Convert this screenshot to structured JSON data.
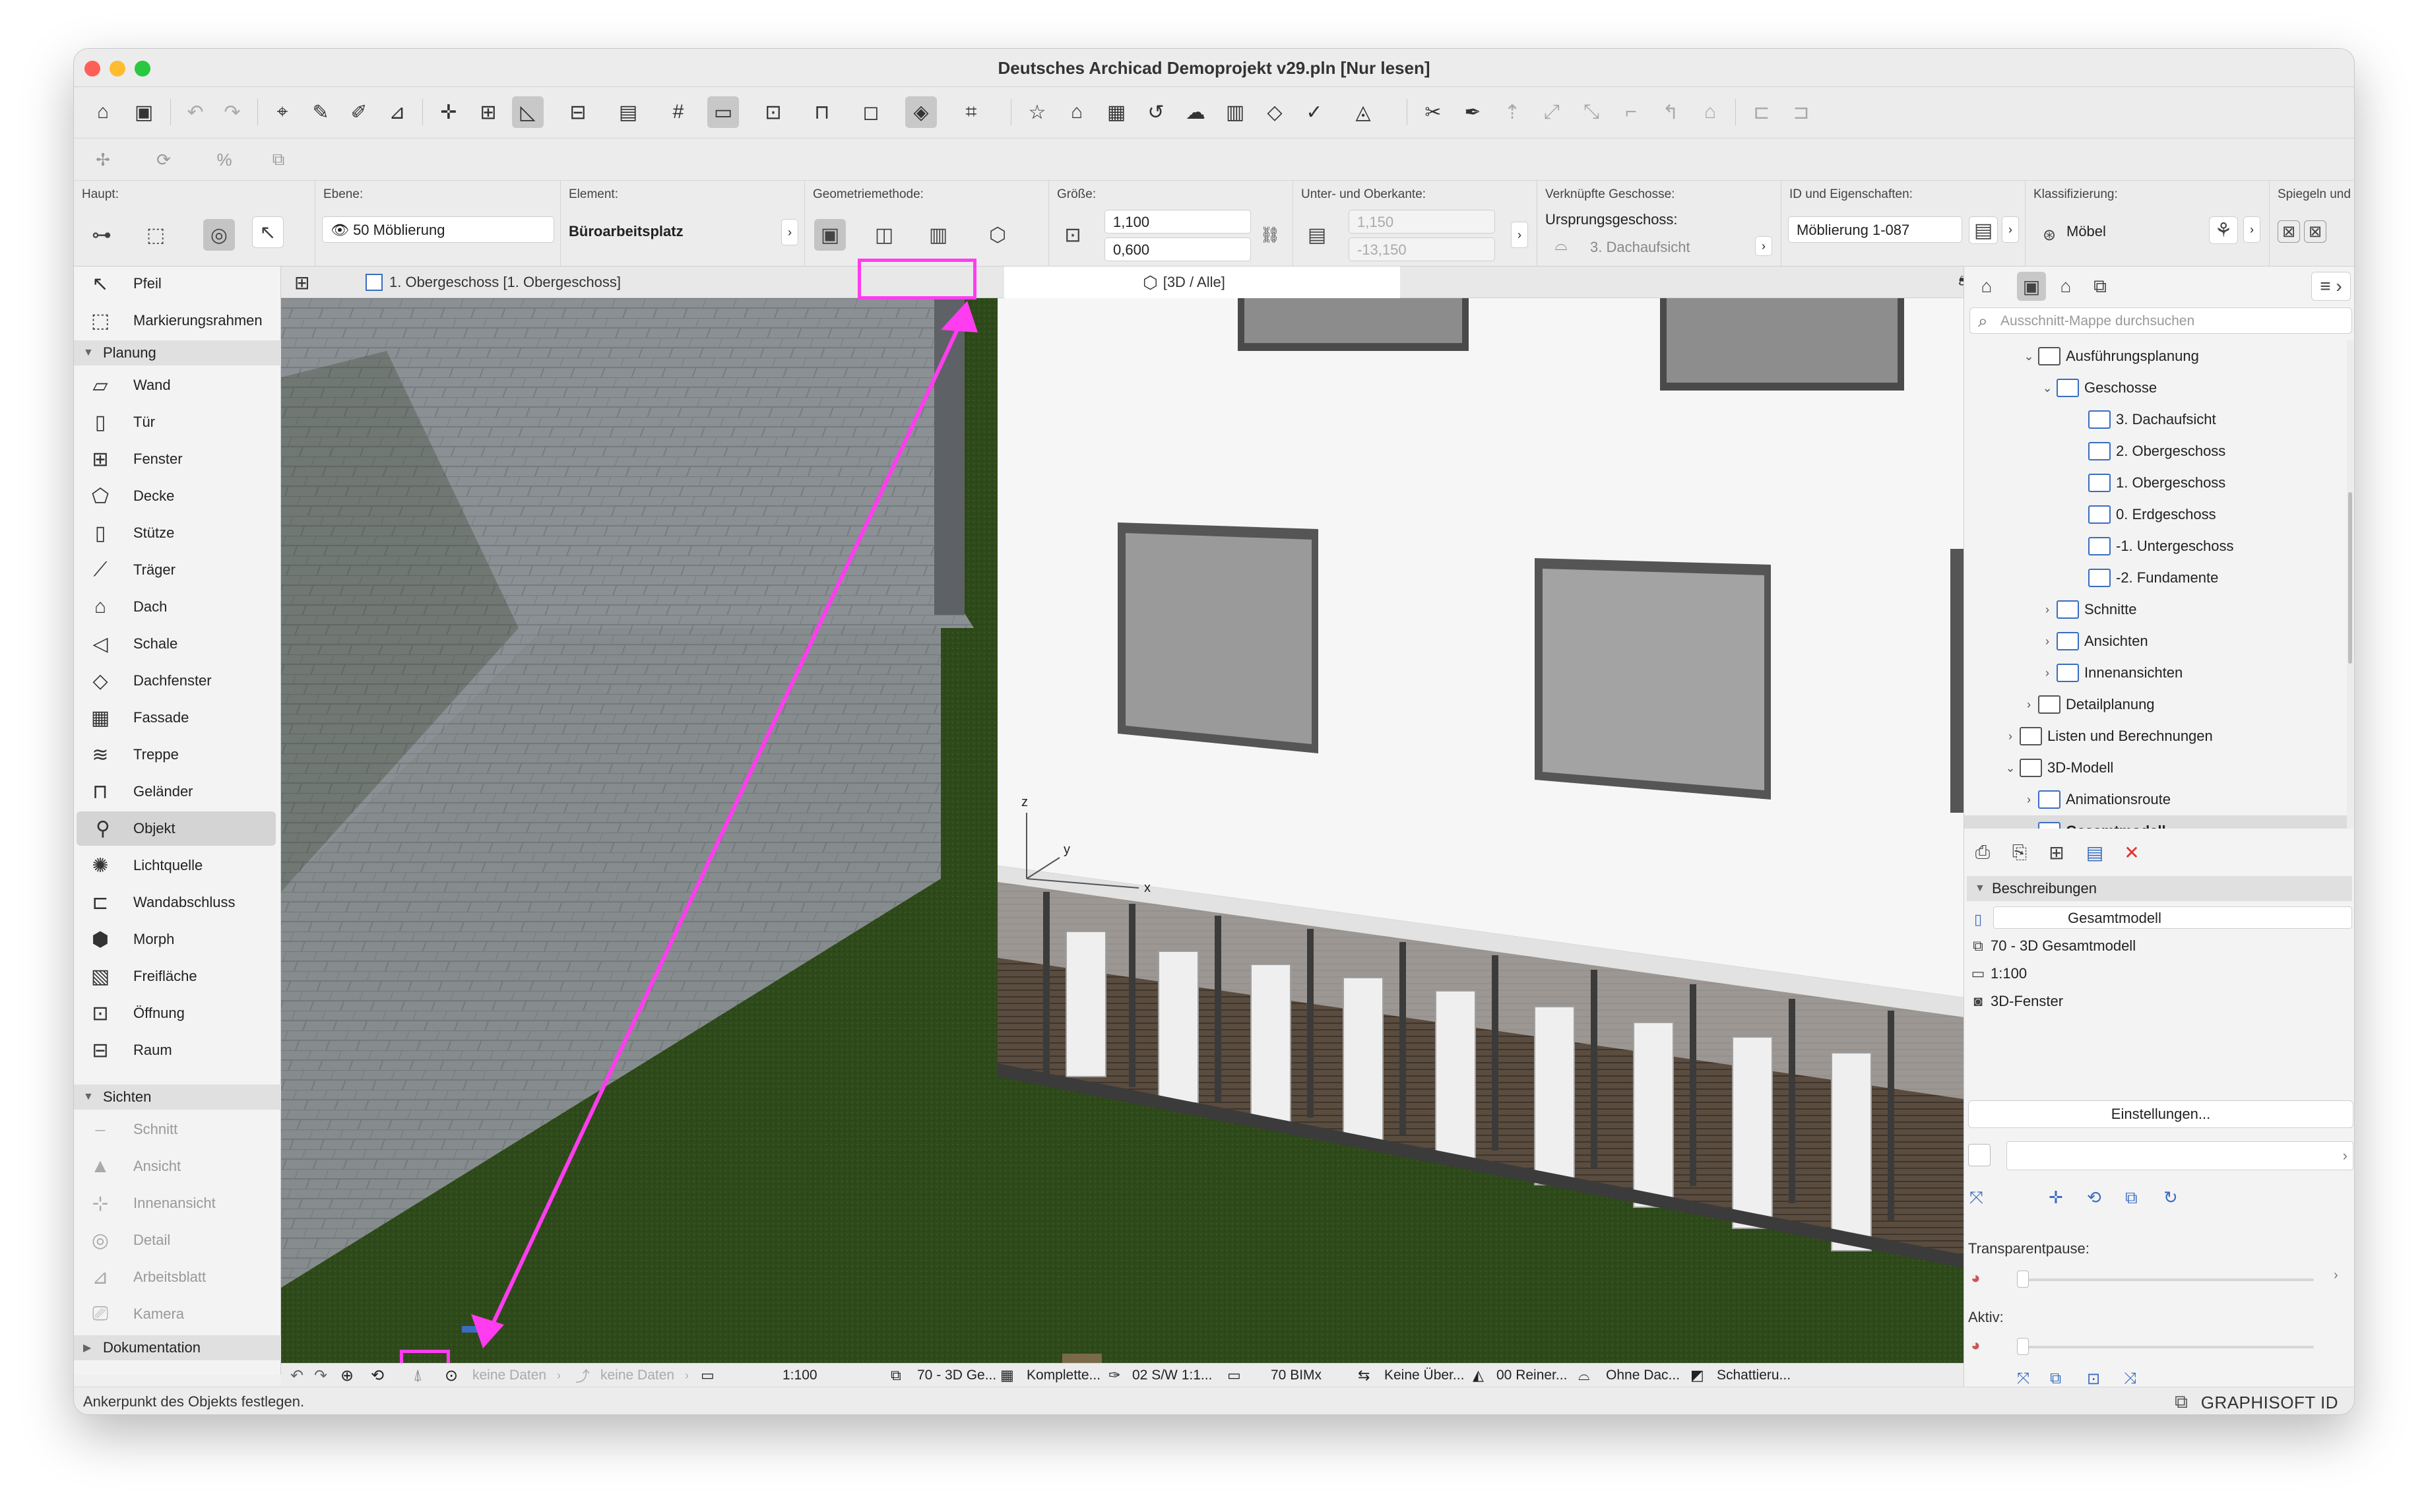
{
  "window": {
    "title": "Deutsches Archicad Demoprojekt v29.pln [Nur lesen]"
  },
  "infobox": {
    "haupt_label": "Haupt:",
    "ebene_label": "Ebene:",
    "ebene_value": "50 Möblierung",
    "element_label": "Element:",
    "element_value": "Büroarbeitsplatz",
    "geometrie_label": "Geometriemethode:",
    "groesse_label": "Größe:",
    "groesse_a": "1,100",
    "groesse_b": "0,600",
    "unter_label": "Unter- und Oberkante:",
    "unter_a": "1,150",
    "unter_b": "-13,150",
    "verk_label": "Verknüpfte Geschosse:",
    "ursprung_label": "Ursprungsgeschoss:",
    "ursprung_value": "3. Dachaufsicht",
    "id_label": "ID und Eigenschaften:",
    "id_value": "Möblierung 1-087",
    "klass_label": "Klassifizierung:",
    "klass_value": "Möbel",
    "spiegeln_label": "Spiegeln und"
  },
  "toolbox": {
    "top_tools": [
      "Pfeil",
      "Markierungsrahmen"
    ],
    "planung_label": "Planung",
    "planung": [
      "Wand",
      "Tür",
      "Fenster",
      "Decke",
      "Stütze",
      "Träger",
      "Dach",
      "Schale",
      "Dachfenster",
      "Fassade",
      "Treppe",
      "Geländer",
      "Objekt",
      "Lichtquelle",
      "Wandabschluss",
      "Morph",
      "Freifläche",
      "Öffnung",
      "Raum"
    ],
    "sichten_label": "Sichten",
    "sichten": [
      "Schnitt",
      "Ansicht",
      "Innenansicht",
      "Detail",
      "Arbeitsblatt",
      "Kamera"
    ],
    "dokumentation_label": "Dokumentation"
  },
  "tabs": {
    "plan_tab": "1. Obergeschoss [1. Obergeschoss]",
    "view_tab": "[3D / Alle]"
  },
  "viewport": {
    "axis_z": "z",
    "axis_y": "y",
    "axis_x": "x"
  },
  "viewbar": {
    "keine1": "keine Daten",
    "keine2": "keine Daten",
    "scale": "1:100",
    "view": "70 - 3D Ge...",
    "model": "Komplette...",
    "pen": "02 S/W 1:1...",
    "bim": "70 BIMx",
    "overr": "Keine Über...",
    "reno": "00 Reiner...",
    "dach": "Ohne Dac...",
    "schatt": "Schattieru..."
  },
  "status": {
    "text": "Ankerpunkt des Objekts festlegen.",
    "brand": "GRAPHISOFT ID"
  },
  "navigator": {
    "search_placeholder": "Ausschnitt-Mappe durchsuchen",
    "tree": [
      {
        "label": "Ausführungsplanung",
        "chev": "⌄",
        "type": "folder"
      },
      {
        "label": "Geschosse",
        "chev": "⌄",
        "type": "view"
      },
      {
        "label": "3. Dachaufsicht",
        "chev": "",
        "type": "view"
      },
      {
        "label": "2. Obergeschoss",
        "chev": "",
        "type": "view"
      },
      {
        "label": "1. Obergeschoss",
        "chev": "",
        "type": "view"
      },
      {
        "label": "0. Erdgeschoss",
        "chev": "",
        "type": "view"
      },
      {
        "label": "-1. Untergeschoss",
        "chev": "",
        "type": "view"
      },
      {
        "label": "-2. Fundamente",
        "chev": "",
        "type": "view"
      },
      {
        "label": "Schnitte",
        "chev": "›",
        "type": "view"
      },
      {
        "label": "Ansichten",
        "chev": "›",
        "type": "view"
      },
      {
        "label": "Innenansichten",
        "chev": "›",
        "type": "view"
      },
      {
        "label": "Detailplanung",
        "chev": "›",
        "type": "folder"
      },
      {
        "label": "Listen und Berechnungen",
        "chev": "›",
        "type": "folder"
      },
      {
        "label": "3D-Modell",
        "chev": "⌄",
        "type": "folder"
      },
      {
        "label": "Animationsroute",
        "chev": "›",
        "type": "view"
      },
      {
        "label": "Gesamtmodell",
        "chev": "",
        "type": "view"
      }
    ],
    "beschreibungen": "Beschreibungen",
    "name_value": "Gesamtmodell",
    "layer_combo": "70 - 3D Gesamtmodell",
    "scale": "1:100",
    "window_type": "3D-Fenster",
    "settings_btn": "Einstellungen...",
    "transparent_label": "Transparentpause:",
    "aktiv_label": "Aktiv:"
  },
  "colors": {
    "highlight": "#ff3cf0",
    "grass": "#2f4a1a",
    "paving": "#8a8f93",
    "facade": "#f4f4f4"
  }
}
